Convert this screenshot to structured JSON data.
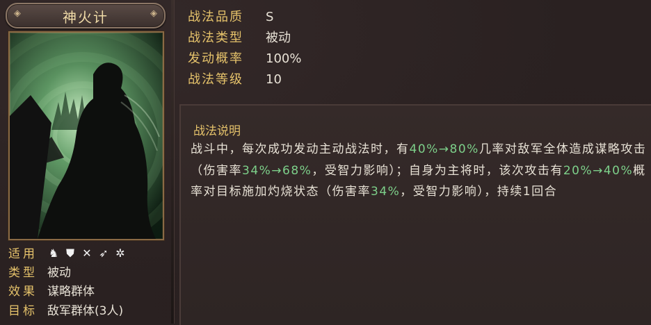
{
  "skill": {
    "name": "神火计"
  },
  "attributes": {
    "applicable_label": "适用",
    "applicable_icons": [
      "cavalry-icon",
      "shield-icon",
      "bow-icon",
      "spear-icon",
      "wheel-icon"
    ],
    "type_label": "类型",
    "type_value": "被动",
    "effect_label": "效果",
    "effect_value": "谋略群体",
    "target_label": "目标",
    "target_value": "敌军群体(3人)"
  },
  "info": {
    "quality_label": "战法品质",
    "quality_value": "S",
    "kind_label": "战法类型",
    "kind_value": "被动",
    "rate_label": "发动概率",
    "rate_value": "100%",
    "level_label": "战法等级",
    "level_value": "10"
  },
  "description": {
    "title": "战法说明",
    "segments": [
      {
        "t": "战斗中，每次成功发动主动战法时，有",
        "hl": false
      },
      {
        "t": "40%→80%",
        "hl": true
      },
      {
        "t": "几率对敌军全体造成谋略攻击（伤害率",
        "hl": false
      },
      {
        "t": "34%→68%",
        "hl": true
      },
      {
        "t": "，受智力影响）；自身为主将时，该次攻击有",
        "hl": false
      },
      {
        "t": "20%→40%",
        "hl": true
      },
      {
        "t": "概率对目标施加灼烧状态（伤害率",
        "hl": false
      },
      {
        "t": "34%",
        "hl": true
      },
      {
        "t": "，受智力影响），持续1回合",
        "hl": false
      }
    ]
  },
  "colors": {
    "label_gold": "#e6c36b",
    "highlight_green": "#7dd08a",
    "text": "#e8e2d6",
    "background": "#2a2121"
  }
}
